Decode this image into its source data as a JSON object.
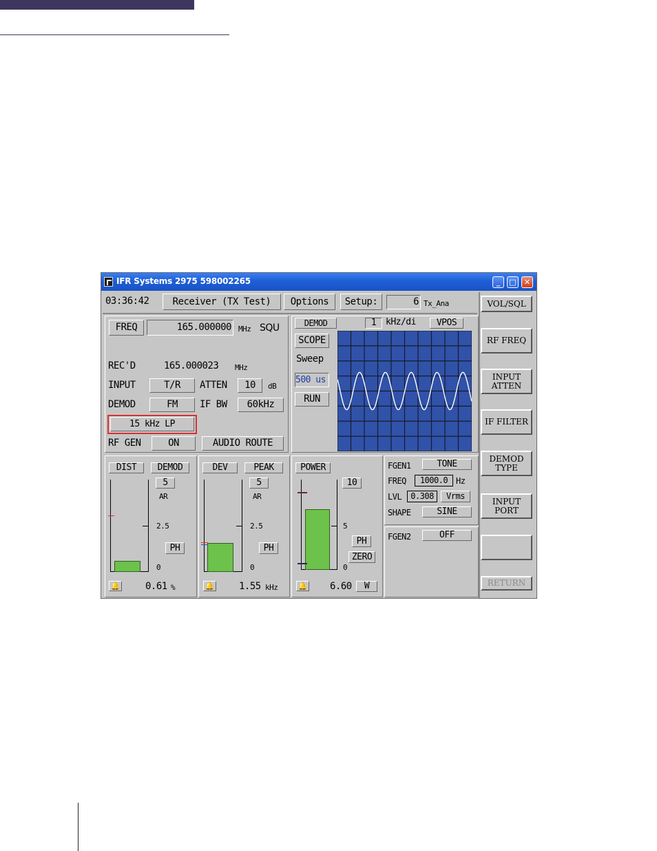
{
  "window": {
    "title": "IFR Systems 2975 598002265",
    "min": "_",
    "max": "□",
    "close": "✕"
  },
  "header": {
    "time": "03:36:42",
    "mode": "Receiver (TX Test)",
    "options": "Options",
    "setup_label": "Setup:",
    "setup_value": "6",
    "setup_name": "Tx_Ana"
  },
  "rx": {
    "freq_label": "FREQ",
    "freq_value": "165.000000",
    "freq_unit": "MHz",
    "squ": "SQU",
    "recd_label": "REC'D",
    "recd_value": "165.000023",
    "recd_unit": "MHz",
    "input_label": "INPUT",
    "input_value": "T/R",
    "atten_label": "ATTEN",
    "atten_value": "10",
    "atten_unit": "dB",
    "demod_label": "DEMOD",
    "demod_value": "FM",
    "ifbw_label": "IF BW",
    "ifbw_value": "60kHz",
    "filter_value": "15 kHz LP",
    "rfgen_label": "RF GEN",
    "rfgen_value": "ON",
    "audio_route": "AUDIO ROUTE"
  },
  "scope": {
    "demod": "DEMOD",
    "div_value": "1",
    "div_unit": "kHz/di",
    "vpos": "VPOS",
    "scope": "SCOPE",
    "sweep": "Sweep",
    "sweep_value": "500 us",
    "run": "RUN",
    "cycles": 5.2
  },
  "meters": {
    "dist": {
      "label": "DIST",
      "mode": "DEMOD",
      "top": "5",
      "ar": "AR",
      "mid": "2.5",
      "ph": "PH",
      "zero": "0",
      "value": "0.61",
      "unit": "%",
      "level": 0.12
    },
    "dev": {
      "label": "DEV",
      "mode": "PEAK",
      "top": "5",
      "ar": "AR",
      "mid": "2.5",
      "ph": "PH",
      "zero": "0",
      "value": "1.55",
      "unit": "kHz",
      "level": 0.31
    },
    "power": {
      "label": "POWER",
      "top": "10",
      "mid": "5",
      "ph": "PH",
      "zero_btn": "ZERO",
      "zero": "0",
      "value": "6.60",
      "unit": "W",
      "level": 0.66
    }
  },
  "fgen": {
    "fgen1_label": "FGEN1",
    "fgen1_value": "TONE",
    "freq_label": "FREQ",
    "freq_value": "1000.0",
    "freq_unit": "Hz",
    "lvl_label": "LVL",
    "lvl_value": "0.308",
    "lvl_unit": "Vrms",
    "shape_label": "SHAPE",
    "shape_value": "SINE",
    "fgen2_label": "FGEN2",
    "fgen2_value": "OFF"
  },
  "softkeys": {
    "vol_sql": "VOL/SQL",
    "rf_freq": "RF FREQ",
    "input_atten_1": "INPUT",
    "input_atten_2": "ATTEN",
    "if_filter": "IF FILTER",
    "demod_type_1": "DEMOD",
    "demod_type_2": "TYPE",
    "input_port_1": "INPUT",
    "input_port_2": "PORT",
    "blank": "",
    "return": "RETURN"
  },
  "colors": {
    "scope_bg": "#3052a8",
    "highlight": "#d93030",
    "bar_fill": "#6cc24a"
  }
}
